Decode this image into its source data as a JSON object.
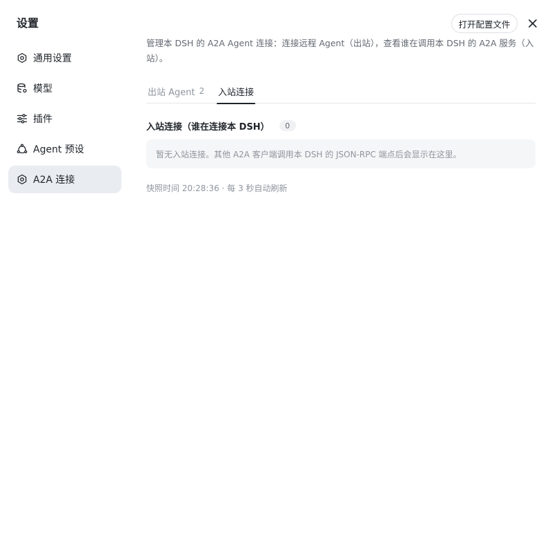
{
  "sidebar": {
    "title": "设置",
    "items": [
      {
        "label": "通用设置",
        "icon": "gear-icon"
      },
      {
        "label": "模型",
        "icon": "database-icon"
      },
      {
        "label": "插件",
        "icon": "sliders-icon"
      },
      {
        "label": "Agent 预设",
        "icon": "agent-icon"
      },
      {
        "label": "A2A 连接",
        "icon": "gear-icon",
        "active": true
      }
    ]
  },
  "header": {
    "open_config_label": "打开配置文件",
    "close_icon": "close-icon"
  },
  "main": {
    "description": "管理本 DSH 的 A2A Agent 连接：连接远程 Agent（出站），查看谁在调用本 DSH 的 A2A 服务（入站）。",
    "tabs": [
      {
        "label": "出站 Agent",
        "count": "2"
      },
      {
        "label": "入站连接",
        "active": true
      }
    ],
    "section": {
      "title": "入站连接（谁在连接本 DSH）",
      "count": "0"
    },
    "empty_message": "暂无入站连接。其他 A2A 客户端调用本 DSH 的 JSON-RPC 端点后会显示在这里。",
    "snapshot_text": "快照时间 20:28:36 · 每 3 秒自动刷新"
  },
  "colors": {
    "active_bg": "#e9ecf0",
    "text_primary": "#1f2329",
    "text_secondary": "#646a73",
    "text_muted": "#8f959e"
  }
}
